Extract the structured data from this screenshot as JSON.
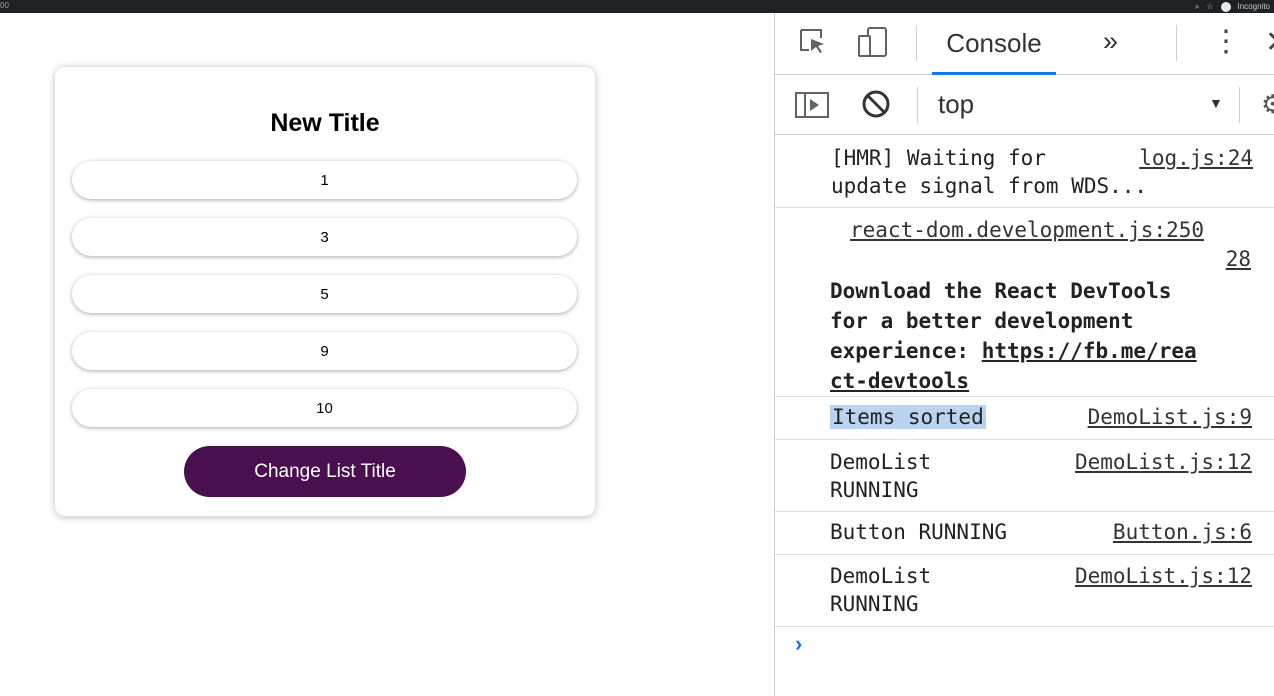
{
  "browser": {
    "left_label": "00",
    "incognito_label": "Incognito"
  },
  "app": {
    "title": "New Title",
    "items": [
      "1",
      "3",
      "5",
      "9",
      "10"
    ],
    "button_label": "Change List Title",
    "button_color": "#4a0f4f"
  },
  "devtools": {
    "tabs": {
      "active": "Console",
      "more": "»"
    },
    "toolbar": {
      "context": "top"
    },
    "messages": [
      {
        "text1": "[HMR] Waiting for",
        "text2": "update signal from WDS...",
        "source": "log.js:24"
      },
      {
        "source1": "react-dom.development.js:250",
        "source2": "28",
        "bold_line1": "Download the React DevTools",
        "bold_line2": "for a better development",
        "bold_line3_prefix": "experience: ",
        "bold_link1": "https://fb.me/rea",
        "bold_link2": "ct-devtools"
      },
      {
        "text": "Items sorted",
        "source": "DemoList.js:9"
      },
      {
        "text1": "DemoList",
        "text2": "RUNNING",
        "source": "DemoList.js:12"
      },
      {
        "text": "Button RUNNING",
        "source": "Button.js:6"
      },
      {
        "text1": "DemoList",
        "text2": "RUNNING",
        "source": "DemoList.js:12"
      }
    ],
    "prompt_symbol": "›",
    "accent_color": "#1a73e8"
  }
}
